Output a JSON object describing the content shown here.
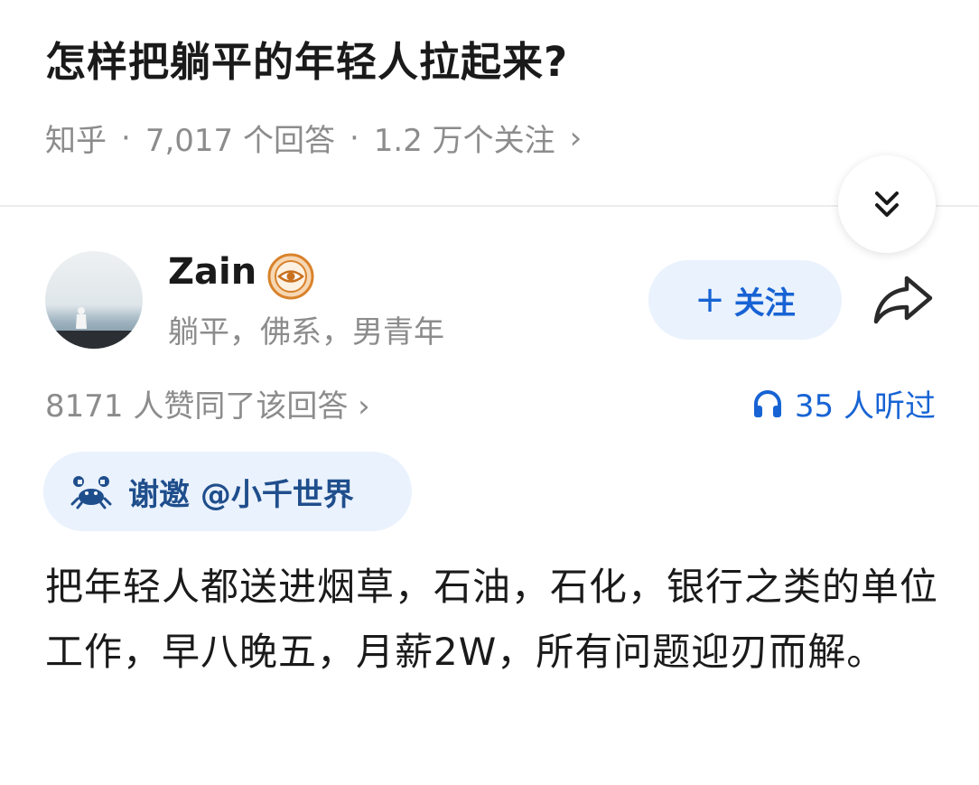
{
  "question": {
    "title": "怎样把躺平的年轻人拉起来?",
    "source": "知乎",
    "separator": "·",
    "answers_count": "7,017 个回答",
    "followers_count": "1.2 万个关注",
    "chevron": "›"
  },
  "author": {
    "name": "Zain",
    "bio": "躺平，佛系，男青年",
    "follow_plus": "+",
    "follow_label": "关注"
  },
  "stats": {
    "votes": "8171 人赞同了该回答 ›",
    "listeners": "35 人听过"
  },
  "invite": {
    "label": "谢邀 @小千世界"
  },
  "answer": {
    "body": "把年轻人都送进烟草，石油，石化，银行之类的单位工作，早八晚五，月薪2W，所有问题迎刃而解。"
  },
  "icons": {
    "collapse": "double-chevron-down-icon",
    "share": "share-arrow-icon",
    "headphones": "headphones-icon",
    "badge": "eye-badge-icon",
    "invite": "crab-icon"
  },
  "colors": {
    "accent": "#1763d4",
    "pill_bg": "#eaf2fd",
    "muted": "#8c8c8c",
    "badge": "#d9822b"
  }
}
